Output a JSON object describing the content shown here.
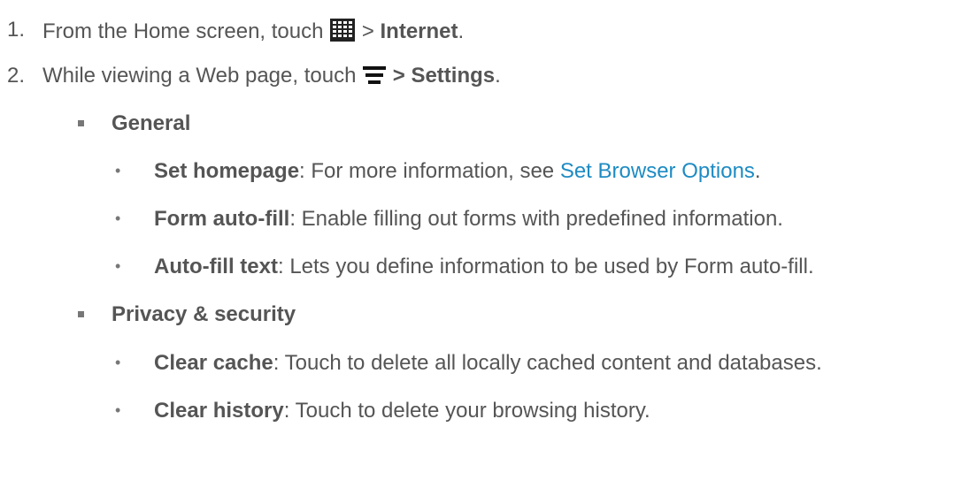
{
  "steps": [
    {
      "number": "1.",
      "text_before": "From the Home screen, touch",
      "icon": "apps-grid-icon",
      "text_sep": " > ",
      "bold": "Internet",
      "text_after": "."
    },
    {
      "number": "2.",
      "text_before": "While viewing a Web page, touch",
      "icon": "menu-icon",
      "bold": "> Settings",
      "text_after": "."
    }
  ],
  "sections": [
    {
      "title": "General",
      "items": [
        {
          "term": "Set homepage",
          "sep": ": For more information, see ",
          "link": "Set Browser Options",
          "tail": "."
        },
        {
          "term": "Form auto-fill",
          "desc": ": Enable filling out forms with predefined information."
        },
        {
          "term": "Auto-fill text",
          "desc": ": Lets you define information to be used by Form auto-fill."
        }
      ]
    },
    {
      "title": "Privacy & security",
      "items": [
        {
          "term": "Clear cache",
          "desc": ": Touch to delete all locally cached content and databases."
        },
        {
          "term": "Clear history",
          "desc": ": Touch to delete your browsing history."
        }
      ]
    }
  ],
  "colors": {
    "text": "#555555",
    "link": "#1e8bc3"
  }
}
